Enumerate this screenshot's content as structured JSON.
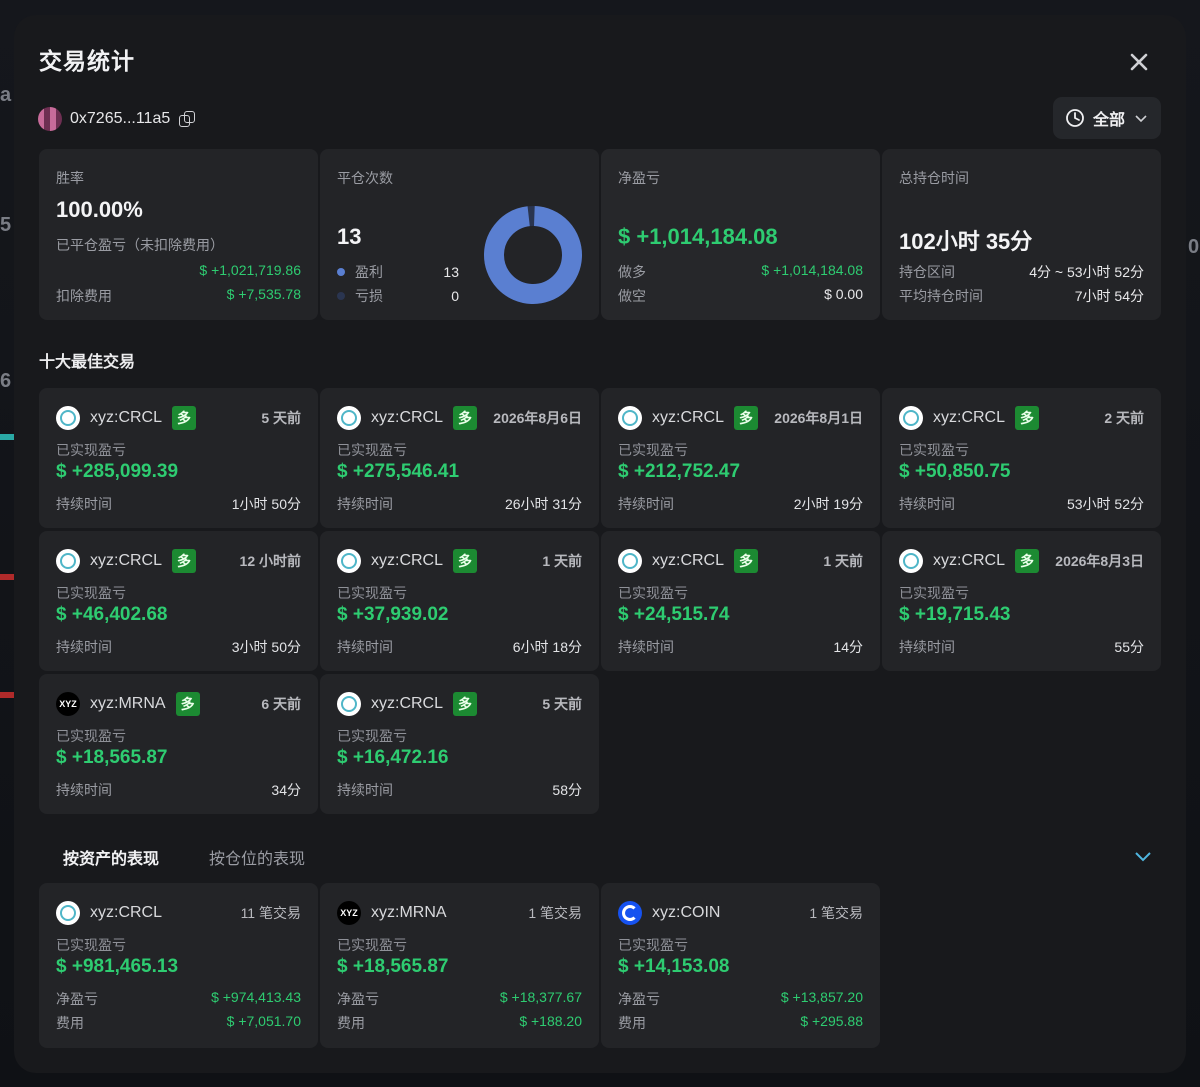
{
  "modal": {
    "title": "交易统计",
    "address": "0x7265...11a5",
    "filter_label": "全部"
  },
  "stats": {
    "win_rate": {
      "label": "胜率",
      "value": "100.00%",
      "closed_pnl_label": "已平仓盈亏（未扣除费用）",
      "closed_pnl_value": "$ +1,021,719.86",
      "fees_label": "扣除费用",
      "fees_value": "$ +7,535.78"
    },
    "close_count": {
      "label": "平仓次数",
      "value": "13",
      "profit_label": "盈利",
      "profit_value": "13",
      "loss_label": "亏损",
      "loss_value": "0",
      "profit_color": "#5a7fd1",
      "loss_color": "#2a3550",
      "profit_fraction": 1.0
    },
    "net_pnl": {
      "label": "净盈亏",
      "value": "$ +1,014,184.08",
      "long_label": "做多",
      "long_value": "$ +1,014,184.08",
      "short_label": "做空",
      "short_value": "$ 0.00"
    },
    "hold_time": {
      "label": "总持仓时间",
      "value": "102小时 35分",
      "range_label": "持仓区间",
      "range_value": "4分 ~ 53小时 52分",
      "avg_label": "平均持仓时间",
      "avg_value": "7小时 54分"
    }
  },
  "top_trades": {
    "title": "十大最佳交易",
    "sub_label": "已实现盈亏",
    "duration_label": "持续时间",
    "long_tag": "多",
    "items": [
      {
        "symbol": "xyz:CRCL",
        "icon": "crcl",
        "time": "5 天前",
        "pnl": "$ +285,099.39",
        "duration": "1小时 50分"
      },
      {
        "symbol": "xyz:CRCL",
        "icon": "crcl",
        "time": "2026年8月6日",
        "pnl": "$ +275,546.41",
        "duration": "26小时 31分"
      },
      {
        "symbol": "xyz:CRCL",
        "icon": "crcl",
        "time": "2026年8月1日",
        "pnl": "$ +212,752.47",
        "duration": "2小时 19分"
      },
      {
        "symbol": "xyz:CRCL",
        "icon": "crcl",
        "time": "2 天前",
        "pnl": "$ +50,850.75",
        "duration": "53小时 52分"
      },
      {
        "symbol": "xyz:CRCL",
        "icon": "crcl",
        "time": "12 小时前",
        "pnl": "$ +46,402.68",
        "duration": "3小时 50分"
      },
      {
        "symbol": "xyz:CRCL",
        "icon": "crcl",
        "time": "1 天前",
        "pnl": "$ +37,939.02",
        "duration": "6小时 18分"
      },
      {
        "symbol": "xyz:CRCL",
        "icon": "crcl",
        "time": "1 天前",
        "pnl": "$ +24,515.74",
        "duration": "14分"
      },
      {
        "symbol": "xyz:CRCL",
        "icon": "crcl",
        "time": "2026年8月3日",
        "pnl": "$ +19,715.43",
        "duration": "55分"
      },
      {
        "symbol": "xyz:MRNA",
        "icon": "xyz",
        "time": "6 天前",
        "pnl": "$ +18,565.87",
        "duration": "34分"
      },
      {
        "symbol": "xyz:CRCL",
        "icon": "crcl",
        "time": "5 天前",
        "pnl": "$ +16,472.16",
        "duration": "58分"
      }
    ]
  },
  "tabs": {
    "by_asset": "按资产的表现",
    "by_position": "按仓位的表现"
  },
  "assets": {
    "sub_label": "已实现盈亏",
    "net_label": "净盈亏",
    "fee_label": "费用",
    "items": [
      {
        "symbol": "xyz:CRCL",
        "icon": "crcl",
        "count": "11 笔交易",
        "pnl": "$ +981,465.13",
        "net": "$ +974,413.43",
        "fee": "$ +7,051.70"
      },
      {
        "symbol": "xyz:MRNA",
        "icon": "xyz",
        "count": "1 笔交易",
        "pnl": "$ +18,565.87",
        "net": "$ +18,377.67",
        "fee": "$ +188.20"
      },
      {
        "symbol": "xyz:COIN",
        "icon": "coin",
        "count": "1 笔交易",
        "pnl": "$ +14,153.08",
        "net": "$ +13,857.20",
        "fee": "$ +295.88"
      }
    ]
  },
  "colors": {
    "positive": "#2ecc71",
    "long_tag": "#1c8a32",
    "card_bg": "#232427",
    "modal_bg": "#18191c"
  }
}
